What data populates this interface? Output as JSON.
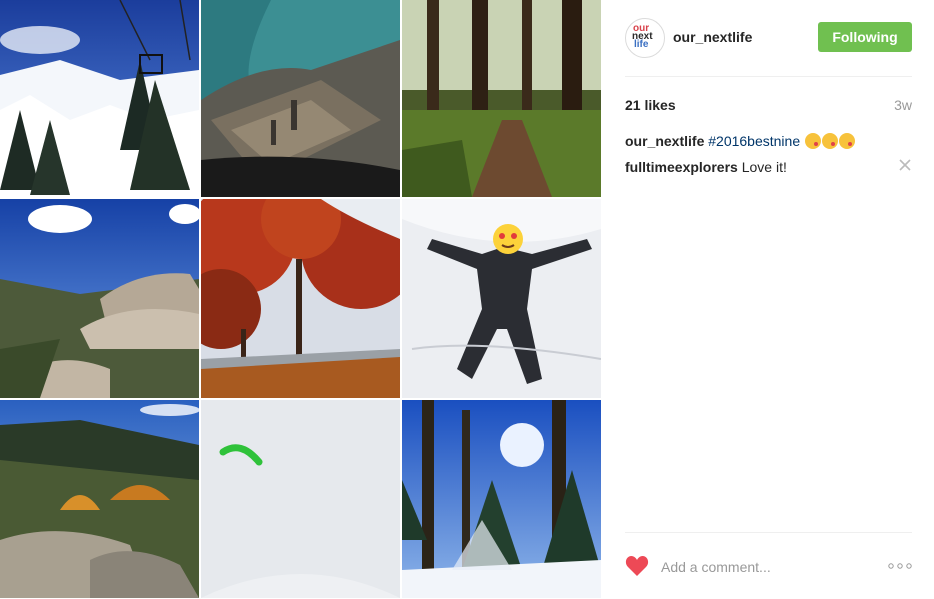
{
  "post": {
    "username": "our_nextlife",
    "follow_label": "Following",
    "likes": "21 likes",
    "time": "3w",
    "caption": {
      "user": "our_nextlife",
      "hashtag": "#2016bestnine"
    },
    "comments": [
      {
        "user": "fulltimeexplorers",
        "text": "Love it!"
      }
    ]
  },
  "avatar_text": [
    "our",
    "next",
    "life"
  ],
  "comment_box": {
    "placeholder": "Add a comment..."
  },
  "icons": {
    "like": "heart-icon",
    "more": "more-options-icon",
    "delete": "close-icon",
    "emoji": "kissing-face-icon"
  },
  "colors": {
    "follow_button": "#70c050",
    "hashtag": "#003569",
    "heart": "#ed4956"
  }
}
